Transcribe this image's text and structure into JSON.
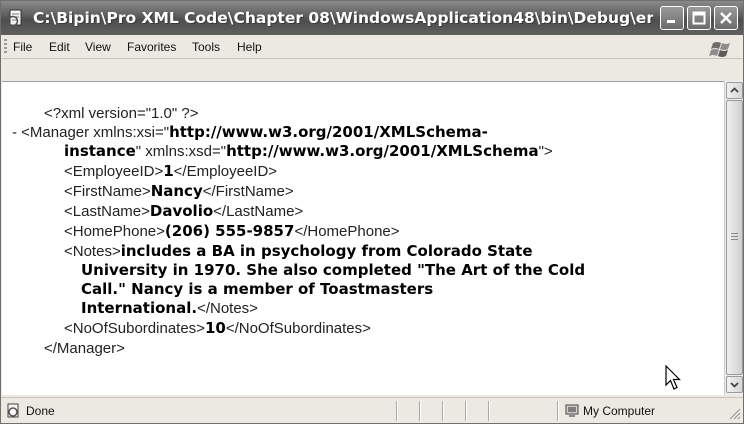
{
  "window": {
    "title": "C:\\Bipin\\Pro XML Code\\Chapter 08\\WindowsApplication48\\bin\\Debug\\empl..."
  },
  "menu": {
    "items": [
      "File",
      "Edit",
      "View",
      "Favorites",
      "Tools",
      "Help"
    ]
  },
  "xml": {
    "decl": "<?xml version=\"1.0\" ?>",
    "collapse": "-",
    "manager_open_prefix": "<Manager xmlns:xsi=\"",
    "xsi_url_part1": "http://www.w3.org/2001/XMLSchema-",
    "xsi_url_part2": "instance",
    "xsd_attr": "\" xmlns:xsd=\"",
    "xsd_url": "http://www.w3.org/2001/XMLSchema",
    "manager_open_suffix": "\">",
    "employee_open": "<EmployeeID>",
    "employee_value": "1",
    "employee_close": "</EmployeeID>",
    "firstname_open": "<FirstName>",
    "firstname_value": "Nancy",
    "firstname_close": "</FirstName>",
    "lastname_open": "<LastName>",
    "lastname_value": "Davolio",
    "lastname_close": "</LastName>",
    "homephone_open": "<HomePhone>",
    "homephone_value": "(206) 555-9857",
    "homephone_close": "</HomePhone>",
    "notes_open": "<Notes>",
    "notes_line1": "includes a BA in psychology from Colorado State",
    "notes_line2": "University in 1970. She also completed \"The Art of the Cold",
    "notes_line3": "Call.\" Nancy is a member of Toastmasters",
    "notes_line4": "International.",
    "notes_close": "</Notes>",
    "subs_open": "<NoOfSubordinates>",
    "subs_value": "10",
    "subs_close": "</NoOfSubordinates>",
    "manager_close": "</Manager>"
  },
  "status": {
    "text": "Done",
    "zone": "My Computer"
  },
  "icons": {
    "title": "ie-document-icon",
    "status": "ie-page-icon",
    "zone": "my-computer-icon"
  }
}
